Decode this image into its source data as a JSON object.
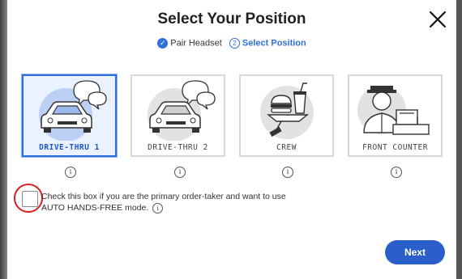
{
  "modal": {
    "title": "Select Your Position",
    "close_icon": "close-icon"
  },
  "steps": {
    "step1_label": "Pair Headset",
    "step1_icon": "check-circle-icon",
    "step2_number": "2",
    "step2_label": "Select Position"
  },
  "positions": [
    {
      "label": "DRIVE-THRU 1",
      "icon": "car-speech-bubbles-icon",
      "selected": true
    },
    {
      "label": "DRIVE-THRU 2",
      "icon": "car-speech-bubbles-icon",
      "selected": false
    },
    {
      "label": "CREW",
      "icon": "burger-drink-hand-icon",
      "selected": false
    },
    {
      "label": "FRONT COUNTER",
      "icon": "cashier-register-icon",
      "selected": false
    }
  ],
  "info_symbol": "i",
  "option": {
    "text_line1": "Check this box if you are the primary order-taker and want to use",
    "text_line2": "AUTO HANDS-FREE mode.",
    "checked": false
  },
  "next_button": "Next",
  "colors": {
    "accent": "#2f6fdc",
    "button": "#2a5fc9",
    "highlight_circle": "#d81e1e"
  }
}
